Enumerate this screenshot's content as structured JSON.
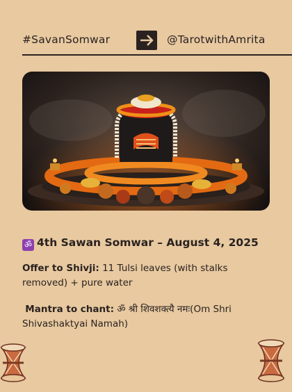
{
  "header": {
    "hashtag": "#SavanSomwar",
    "handle": "@TarotwithAmrita",
    "arrow_icon": "right-arrow-icon"
  },
  "photo": {
    "subject": "shivling-decorated-with-marigold-garlands"
  },
  "title": {
    "om_symbol": "ॐ",
    "text": "4th Sawan Somwar – August 4, 2025"
  },
  "offer": {
    "label": "Offer to Shivji:",
    "text": "11 Tulsi leaves (with stalks removed) + pure water"
  },
  "mantra": {
    "label": "Mantra to chant:",
    "text": "ॐ श्री शिवशक्त्यै नमः(Om Shri Shivashaktyai Namah)"
  },
  "colors": {
    "background": "#e8c9a0",
    "text": "#2a2220",
    "om_badge": "#8d3fb0"
  }
}
